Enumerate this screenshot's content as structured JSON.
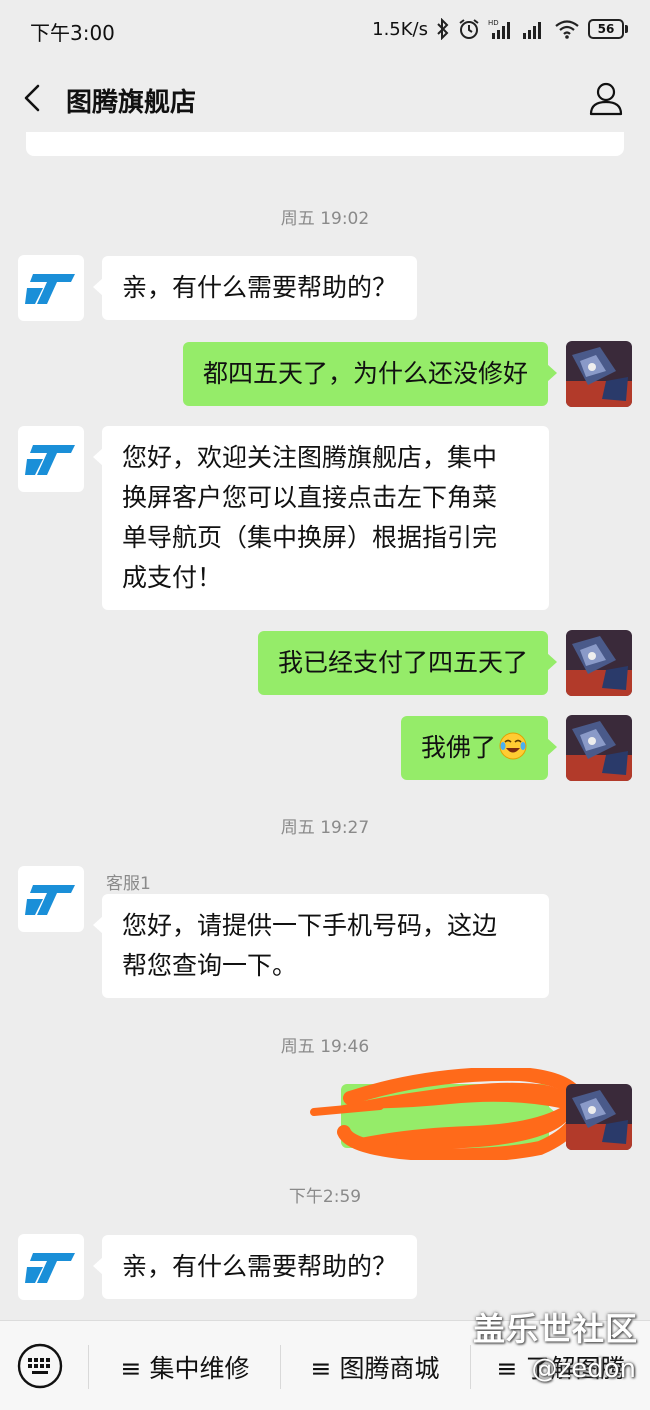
{
  "status_bar": {
    "time": "下午3:00",
    "network_speed": "1.5K/s",
    "battery": "56",
    "icons": [
      "bluetooth-icon",
      "alarm-icon",
      "hd-signal-icon",
      "signal-icon",
      "wifi-icon",
      "battery-icon"
    ]
  },
  "header": {
    "title": "图腾旗舰店",
    "back_icon": "chevron-left-icon",
    "profile_icon": "person-icon"
  },
  "messages": [
    {
      "type": "timestamp",
      "text": "周五 19:02"
    },
    {
      "type": "incoming",
      "text": "亲，有什么需要帮助的？"
    },
    {
      "type": "outgoing",
      "text": "都四五天了，为什么还没修好"
    },
    {
      "type": "incoming",
      "lines": [
        "您好，欢迎关注图腾旗舰店，集中",
        "换屏客户您可以直接点击左下角菜",
        "单导航页（集中换屏）根据指引完",
        "成支付！"
      ]
    },
    {
      "type": "outgoing",
      "text": "我已经支付了四五天了"
    },
    {
      "type": "outgoing",
      "text": "我佛了",
      "emoji": "crying-laughing-face"
    },
    {
      "type": "timestamp",
      "text": "周五 19:27"
    },
    {
      "type": "incoming",
      "sender": "客服1",
      "lines": [
        "您好，请提供一下手机号码，这边",
        "帮您查询一下。"
      ]
    },
    {
      "type": "timestamp",
      "text": "周五 19:46"
    },
    {
      "type": "outgoing",
      "redacted": true
    },
    {
      "type": "timestamp",
      "text": "下午2:59"
    },
    {
      "type": "incoming",
      "text": "亲，有什么需要帮助的？"
    }
  ],
  "bottom_menu": {
    "keyboard_icon": "keyboard-icon",
    "items": [
      {
        "label": "≡ 集中维修"
      },
      {
        "label": "≡ 图腾商城"
      },
      {
        "label": "≡ 了解图腾"
      }
    ]
  },
  "watermark": {
    "text": "盖乐世社区",
    "sub": "@zedon"
  },
  "colors": {
    "background": "#ededed",
    "incoming_bubble": "#ffffff",
    "outgoing_bubble": "#95ec69",
    "brand_logo": "#1a8fd8",
    "redaction": "#ff6a1a"
  }
}
